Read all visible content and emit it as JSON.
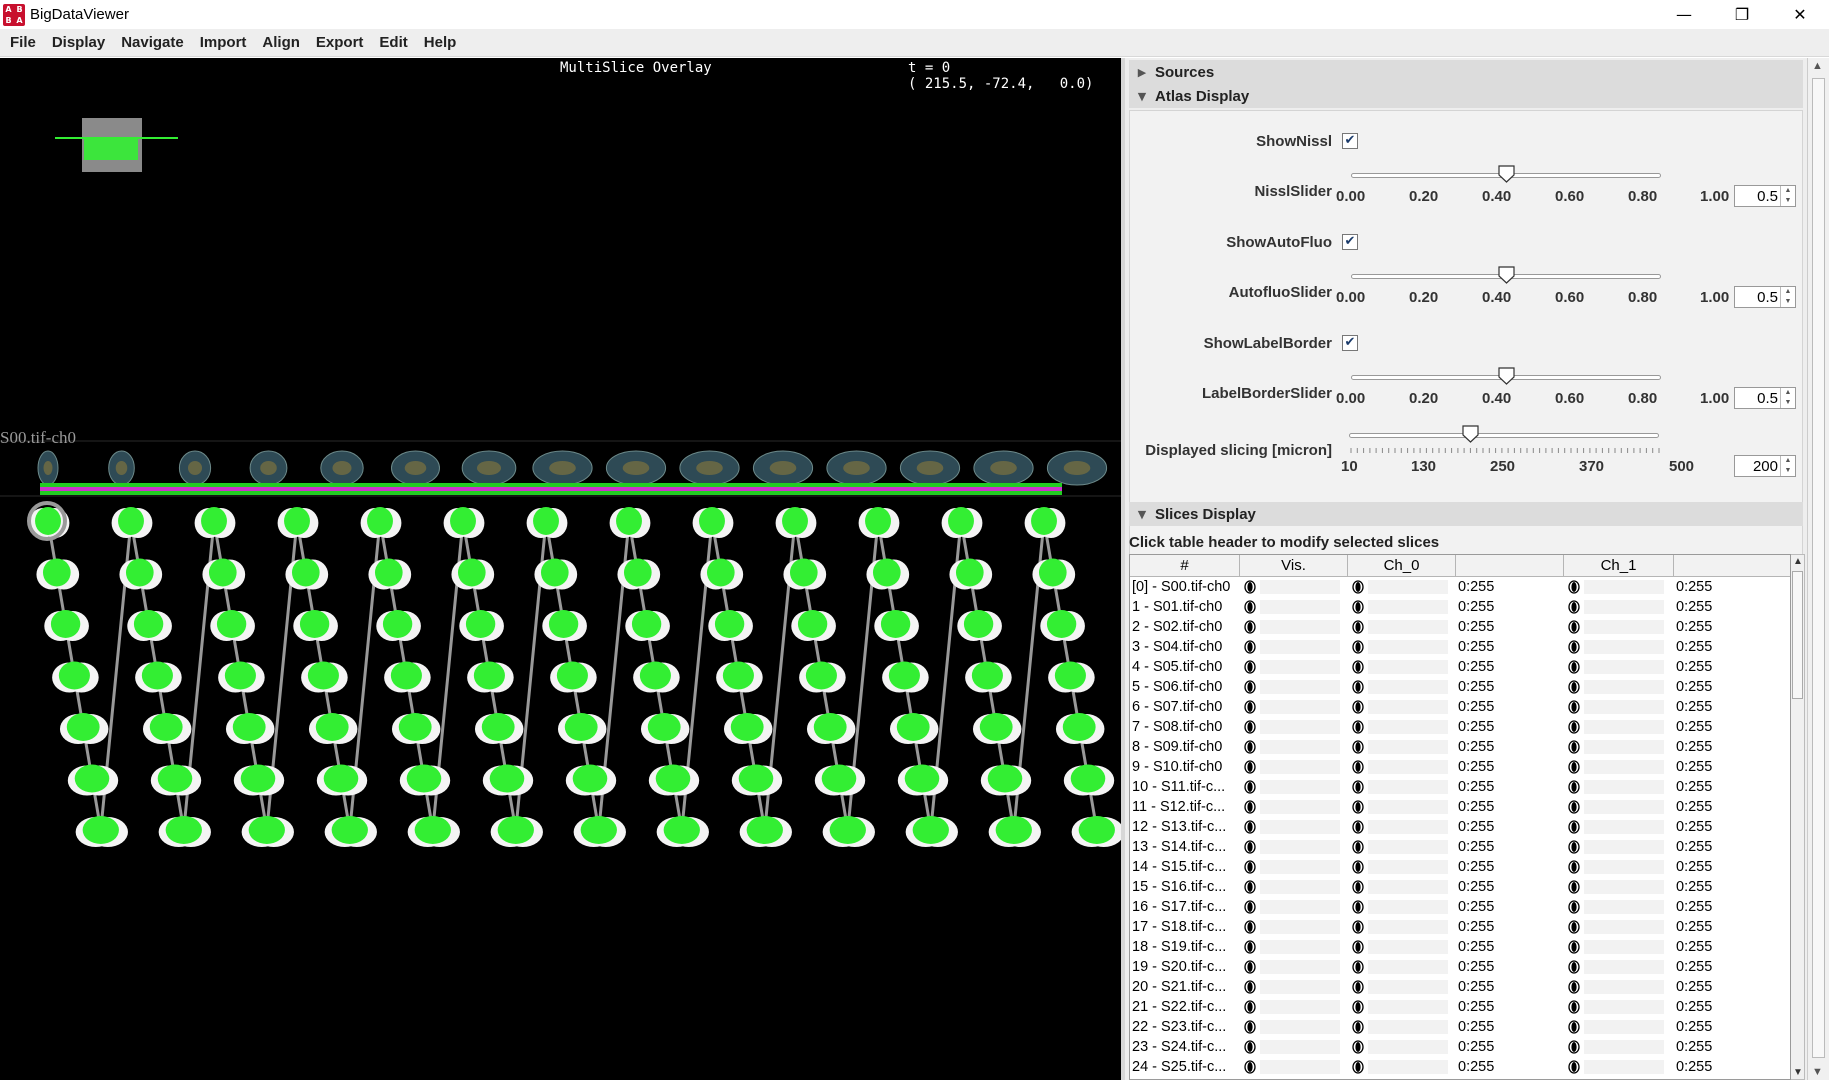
{
  "window": {
    "title": "BigDataViewer",
    "icon_text": [
      "A",
      "B",
      "B",
      "A"
    ],
    "controls": {
      "minimize": "—",
      "restore": "❐",
      "close": "✕"
    }
  },
  "menu": [
    "File",
    "Display",
    "Navigate",
    "Import",
    "Align",
    "Export",
    "Edit",
    "Help"
  ],
  "viewer": {
    "title": "MultiSlice Overlay",
    "time": "t = 0",
    "coords": "( 215.5, -72.4,   0.0)",
    "source_label": "S00.tif-ch0",
    "colors": {
      "slice_fill": "#33ee33",
      "tissue": "#f4f4f4",
      "link_line": "#999999",
      "bar_outer": "#22cc22",
      "bar_inner": "#cc33cc"
    }
  },
  "panel": {
    "sources_label": "Sources",
    "atlas_display_label": "Atlas Display",
    "atlas": {
      "show_nissl": {
        "label": "ShowNissl",
        "checked": true,
        "mark": "✔"
      },
      "nissl_slider": {
        "label": "NisslSlider",
        "value": "0.5",
        "fraction": 0.5
      },
      "show_autofluo": {
        "label": "ShowAutoFluo",
        "checked": true,
        "mark": "✔"
      },
      "autofluo_slider": {
        "label": "AutofluoSlider",
        "value": "0.5",
        "fraction": 0.5
      },
      "show_label_border": {
        "label": "ShowLabelBorder",
        "checked": true,
        "mark": "✔"
      },
      "label_border_slider": {
        "label": "LabelBorderSlider",
        "value": "0.5",
        "fraction": 0.5
      },
      "opacity_ticks": [
        "0.00",
        "0.20",
        "0.40",
        "0.60",
        "0.80",
        "1.00"
      ],
      "slicing": {
        "label": "Displayed slicing [micron]",
        "value": "200",
        "ticks": [
          "10",
          "130",
          "250",
          "370",
          "500"
        ],
        "min": 10,
        "max": 500
      }
    },
    "slices_display_label": "Slices Display",
    "hint": "Click table header to modify selected slices",
    "table": {
      "headers": [
        "#",
        "Vis.",
        "Ch_0",
        "",
        "Ch_1"
      ],
      "rows": [
        {
          "name": "[0] - S00.tif-ch0",
          "ch0": "0:255",
          "ch1": "0:255"
        },
        {
          "name": "1  - S01.tif-ch0",
          "ch0": "0:255",
          "ch1": "0:255"
        },
        {
          "name": "2  - S02.tif-ch0",
          "ch0": "0:255",
          "ch1": "0:255"
        },
        {
          "name": "3  - S04.tif-ch0",
          "ch0": "0:255",
          "ch1": "0:255"
        },
        {
          "name": "4  - S05.tif-ch0",
          "ch0": "0:255",
          "ch1": "0:255"
        },
        {
          "name": "5  - S06.tif-ch0",
          "ch0": "0:255",
          "ch1": "0:255"
        },
        {
          "name": "6  - S07.tif-ch0",
          "ch0": "0:255",
          "ch1": "0:255"
        },
        {
          "name": "7  - S08.tif-ch0",
          "ch0": "0:255",
          "ch1": "0:255"
        },
        {
          "name": "8  - S09.tif-ch0",
          "ch0": "0:255",
          "ch1": "0:255"
        },
        {
          "name": "9  - S10.tif-ch0",
          "ch0": "0:255",
          "ch1": "0:255"
        },
        {
          "name": "10  - S11.tif-c...",
          "ch0": "0:255",
          "ch1": "0:255"
        },
        {
          "name": "11  - S12.tif-c...",
          "ch0": "0:255",
          "ch1": "0:255"
        },
        {
          "name": "12  - S13.tif-c...",
          "ch0": "0:255",
          "ch1": "0:255"
        },
        {
          "name": "13  - S14.tif-c...",
          "ch0": "0:255",
          "ch1": "0:255"
        },
        {
          "name": "14  - S15.tif-c...",
          "ch0": "0:255",
          "ch1": "0:255"
        },
        {
          "name": "15  - S16.tif-c...",
          "ch0": "0:255",
          "ch1": "0:255"
        },
        {
          "name": "16  - S17.tif-c...",
          "ch0": "0:255",
          "ch1": "0:255"
        },
        {
          "name": "17  - S18.tif-c...",
          "ch0": "0:255",
          "ch1": "0:255"
        },
        {
          "name": "18  - S19.tif-c...",
          "ch0": "0:255",
          "ch1": "0:255"
        },
        {
          "name": "19  - S20.tif-c...",
          "ch0": "0:255",
          "ch1": "0:255"
        },
        {
          "name": "20  - S21.tif-c...",
          "ch0": "0:255",
          "ch1": "0:255"
        },
        {
          "name": "21  - S22.tif-c...",
          "ch0": "0:255",
          "ch1": "0:255"
        },
        {
          "name": "22  - S23.tif-c...",
          "ch0": "0:255",
          "ch1": "0:255"
        },
        {
          "name": "23  - S24.tif-c...",
          "ch0": "0:255",
          "ch1": "0:255"
        },
        {
          "name": "24  - S25.tif-c...",
          "ch0": "0:255",
          "ch1": "0:255"
        }
      ]
    }
  }
}
